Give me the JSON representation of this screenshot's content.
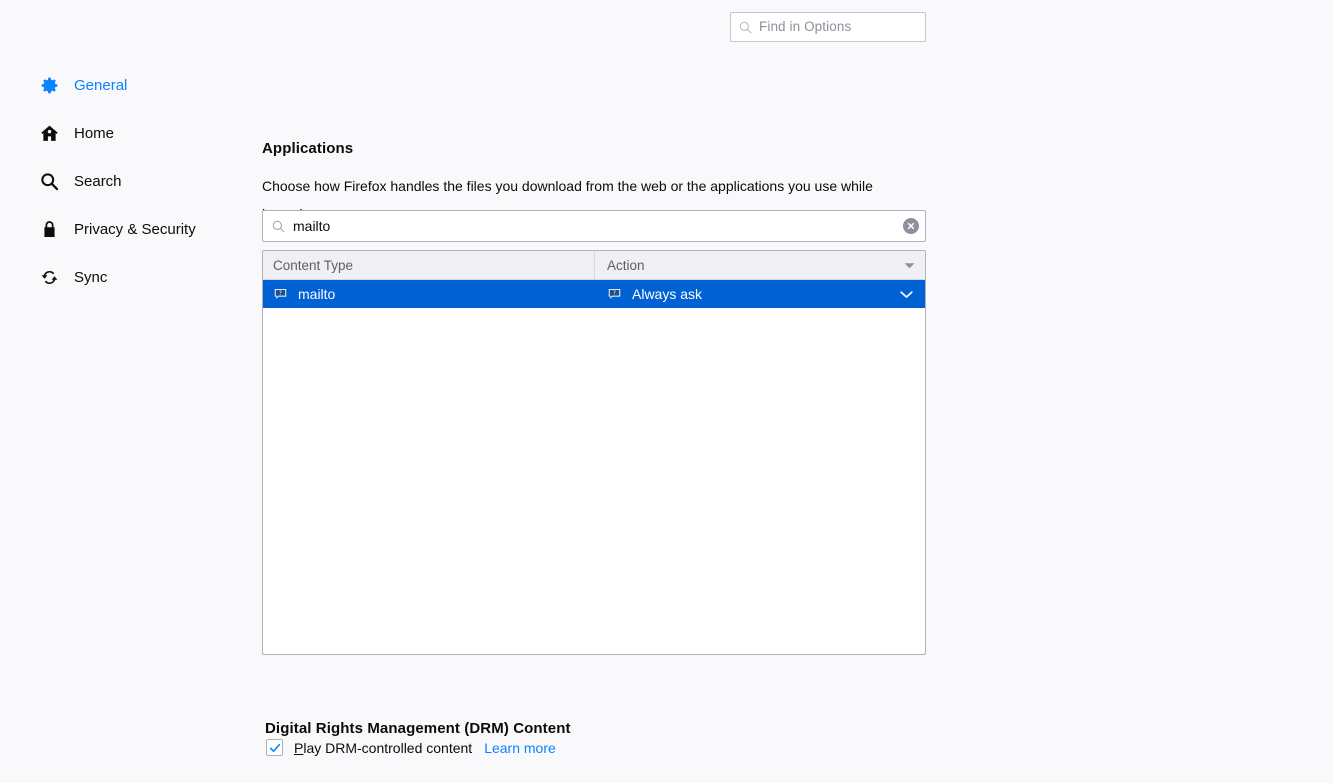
{
  "find": {
    "placeholder": "Find in Options",
    "icon": "search-icon"
  },
  "sidebar": {
    "items": [
      {
        "id": "general",
        "label": "General",
        "icon": "gear-icon",
        "active": true
      },
      {
        "id": "home",
        "label": "Home",
        "icon": "home-icon",
        "active": false
      },
      {
        "id": "search",
        "label": "Search",
        "icon": "search-icon",
        "active": false
      },
      {
        "id": "privacy",
        "label": "Privacy & Security",
        "icon": "lock-icon",
        "active": false
      },
      {
        "id": "sync",
        "label": "Sync",
        "icon": "sync-icon",
        "active": false
      }
    ]
  },
  "applications": {
    "title": "Applications",
    "description": "Choose how Firefox handles the files you download from the web or the applications you use while browsing.",
    "filter": {
      "value": "mailto",
      "search_icon": "search-icon",
      "clear_icon": "clear-circle-icon"
    },
    "table": {
      "columns": [
        {
          "key": "content_type",
          "label": "Content Type"
        },
        {
          "key": "action",
          "label": "Action",
          "sort_indicator": "sort-descending-icon"
        }
      ],
      "rows": [
        {
          "content_type": "mailto",
          "content_type_icon": "handler-bubble-icon",
          "action": "Always ask",
          "action_icon": "handler-bubble-icon",
          "dropdown_icon": "chevron-down-icon",
          "selected": true
        }
      ]
    }
  },
  "drm": {
    "title": "Digital Rights Management (DRM) Content",
    "checkbox": {
      "label_accesskey": "P",
      "label_rest": "lay DRM-controlled content",
      "checked": true,
      "check_icon": "checkmark-icon"
    },
    "learn_more": "Learn more"
  },
  "colors": {
    "page_background": "#f9f9fb",
    "accent_blue": "#0a84ff",
    "selection_blue": "#0061d4",
    "panel_white": "#ffffff",
    "border_gray": "#b1b1b9",
    "header_gray": "#f0f0f4",
    "muted_text": "#5e5e6b"
  }
}
